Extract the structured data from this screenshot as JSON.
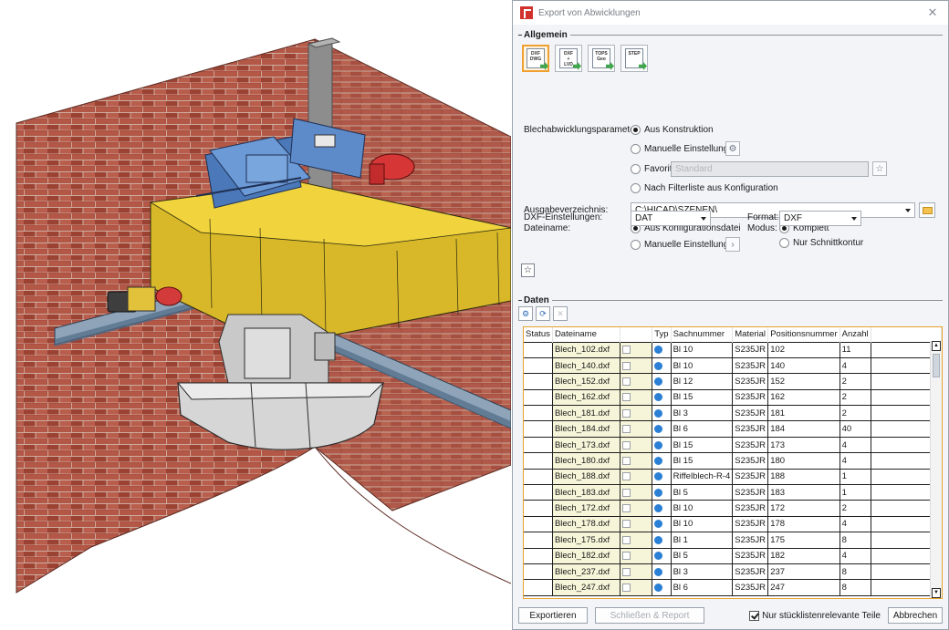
{
  "dialog": {
    "title": "Export von Abwicklungen",
    "close_icon": "close-icon",
    "general_section": "Allgemein",
    "data_section": "Daten",
    "formats": [
      {
        "line1": "DXF",
        "line2": "DWG",
        "line3": "",
        "icon": "dxf-dwg-export-icon"
      },
      {
        "line1": "DXF",
        "line2": "+",
        "line3": "LVD",
        "icon": "dxf-lvd-export-icon"
      },
      {
        "line1": "TOPS",
        "line2": "Geo",
        "line3": "",
        "icon": "tops-geo-export-icon"
      },
      {
        "line1": "STEP",
        "line2": "",
        "line3": "",
        "icon": "step-export-icon"
      }
    ],
    "params_label": "Blechabwicklungsparameter:",
    "opt_construction": "Aus Konstruktion",
    "opt_manual": "Manuelle Einstellungen",
    "opt_favorit": "Favorit",
    "favorit_placeholder": "Standard",
    "opt_filter": "Nach Filterliste aus Konfiguration",
    "outdir_label": "Ausgabeverzeichnis:",
    "outdir_value": "C:\\HICAD\\SZENEN\\",
    "filename_label": "Dateiname:",
    "opt_config_file": "Aus Konfigurationsdatei",
    "opt_manual2": "Manuelle Einstellungen",
    "mode_label": "Modus:",
    "opt_complete": "Komplett",
    "opt_cutcontour": "Nur Schnittkontur",
    "dxf_settings_label": "DXF-Einstellungen:",
    "dxf_value": "DAT",
    "format_label": "Format:",
    "format_value": "DXF",
    "columns": [
      "Status",
      "Dateiname",
      "",
      "Typ",
      "Sachnummer",
      "Material",
      "Positionsnummer",
      "Anzahl"
    ],
    "rows": [
      [
        "Blech_102.dxf",
        "Bl 10",
        "S235JR",
        "102",
        "11"
      ],
      [
        "Blech_140.dxf",
        "Bl 10",
        "S235JR",
        "140",
        "4"
      ],
      [
        "Blech_152.dxf",
        "Bl 12",
        "S235JR",
        "152",
        "2"
      ],
      [
        "Blech_162.dxf",
        "Bl 15",
        "S235JR",
        "162",
        "2"
      ],
      [
        "Blech_181.dxf",
        "Bl 3",
        "S235JR",
        "181",
        "2"
      ],
      [
        "Blech_184.dxf",
        "Bl 6",
        "S235JR",
        "184",
        "40"
      ],
      [
        "Blech_173.dxf",
        "Bl 15",
        "S235JR",
        "173",
        "4"
      ],
      [
        "Blech_180.dxf",
        "Bl 15",
        "S235JR",
        "180",
        "4"
      ],
      [
        "Blech_188.dxf",
        "Riffelblech-R-4",
        "S235JR",
        "188",
        "1"
      ],
      [
        "Blech_183.dxf",
        "Bl 5",
        "S235JR",
        "183",
        "1"
      ],
      [
        "Blech_172.dxf",
        "Bl 10",
        "S235JR",
        "172",
        "2"
      ],
      [
        "Blech_178.dxf",
        "Bl 10",
        "S235JR",
        "178",
        "4"
      ],
      [
        "Blech_175.dxf",
        "Bl 1",
        "S235JR",
        "175",
        "8"
      ],
      [
        "Blech_182.dxf",
        "Bl 5",
        "S235JR",
        "182",
        "4"
      ],
      [
        "Blech_237.dxf",
        "Bl 3",
        "S235JR",
        "237",
        "8"
      ],
      [
        "Blech_247.dxf",
        "Bl 6",
        "S235JR",
        "247",
        "8"
      ]
    ],
    "export_btn": "Exportieren",
    "close_report_btn": "Schließen & Report",
    "only_bom_label": "Nur stücklistenrelevante Teile",
    "cancel_btn": "Abbrechen"
  }
}
